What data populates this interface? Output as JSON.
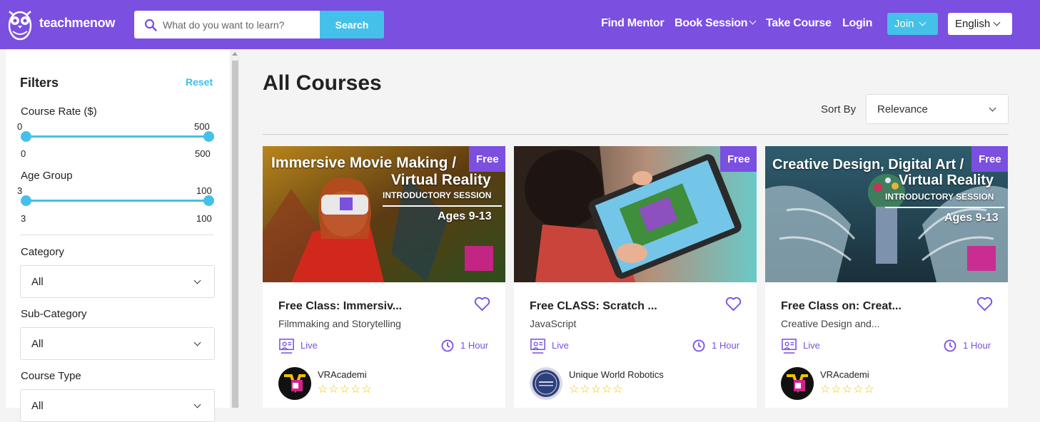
{
  "header": {
    "brand": "teachmenow",
    "search_placeholder": "What do you want to learn?",
    "search_button": "Search",
    "nav": [
      "Find Mentor",
      "Book Session",
      "Take Course",
      "Login"
    ],
    "join": "Join",
    "language": "English",
    "accent": "#7b4fe0",
    "button_color": "#44c1e8"
  },
  "filters": {
    "title": "Filters",
    "reset": "Reset",
    "course_rate": {
      "label": "Course Rate ($)",
      "min": "0",
      "max": "500",
      "low": "0",
      "high": "500"
    },
    "age_group": {
      "label": "Age Group",
      "min": "3",
      "max": "100",
      "low": "3",
      "high": "100"
    },
    "category": {
      "label": "Category",
      "value": "All"
    },
    "sub_category": {
      "label": "Sub-Category",
      "value": "All"
    },
    "course_type": {
      "label": "Course Type",
      "value": "All"
    }
  },
  "main": {
    "title": "All Courses",
    "sort_label": "Sort By",
    "sort_value": "Relevance"
  },
  "cards": [
    {
      "badge": "Free",
      "banner_title_1": "Immersive Movie Making /",
      "banner_title_2": "Virtual Reality",
      "banner_session": "INTRODUCTORY SESSION",
      "banner_ages": "Ages 9-13",
      "title": "Free Class: Immersiv...",
      "subtitle": "Filmmaking and Storytelling",
      "mode": "Live",
      "duration": "1 Hour",
      "author": "VRAcademi",
      "rating": "☆☆☆☆☆"
    },
    {
      "badge": "Free",
      "title": "Free CLASS: Scratch ...",
      "subtitle": "JavaScript",
      "mode": "Live",
      "duration": "1 Hour",
      "author": "Unique World Robotics",
      "rating": "☆☆☆☆☆"
    },
    {
      "badge": "Free",
      "banner_title_1": "Creative Design, Digital Art /",
      "banner_title_2": "Virtual Reality",
      "banner_session": "INTRODUCTORY SESSION",
      "banner_ages": "Ages 9-13",
      "title": "Free Class on: Creat...",
      "subtitle": "Creative Design and...",
      "mode": "Live",
      "duration": "1 Hour",
      "author": "VRAcademi",
      "rating": "☆☆☆☆☆"
    }
  ]
}
